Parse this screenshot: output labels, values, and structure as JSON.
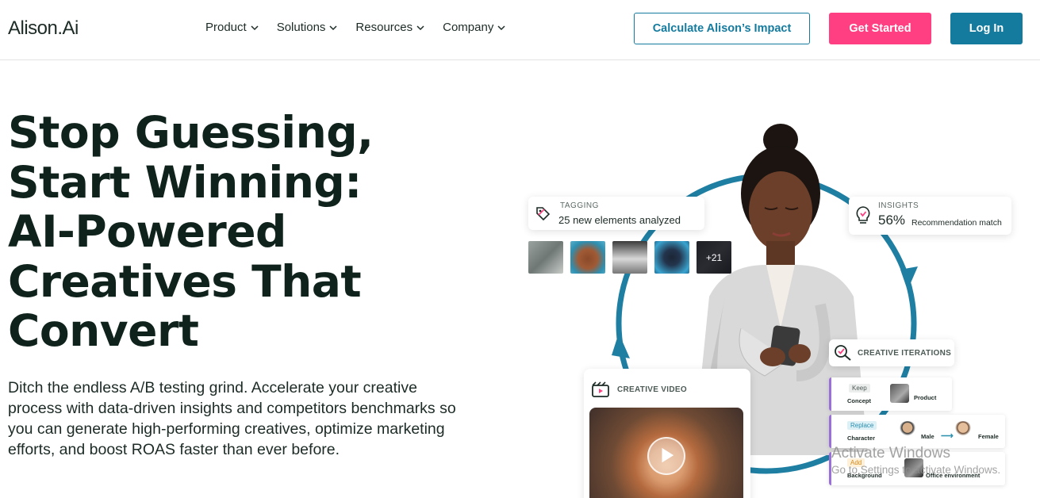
{
  "header": {
    "logo": "Alison.Ai",
    "nav": [
      {
        "label": "Product"
      },
      {
        "label": "Solutions"
      },
      {
        "label": "Resources"
      },
      {
        "label": "Company"
      }
    ],
    "impact_button": "Calculate Alison’s Impact",
    "start_button": "Get Started",
    "login_button": "Log In"
  },
  "hero": {
    "headline": [
      "Stop Guessing,",
      "Start Winning:",
      "AI-Powered",
      "Creatives That",
      "Convert"
    ],
    "subtext": "Ditch the endless A/B testing grind. Accelerate your creative process with data-driven insights and competitors benchmarks so you can generate high-performing creatives, optimize marketing efforts, and boost ROAS faster than ever before."
  },
  "visual": {
    "tagging": {
      "title": "TAGGING",
      "text": "25 new elements analyzed",
      "more": "+21"
    },
    "insights": {
      "title": "INSIGHTS",
      "value": "56%",
      "label": "Recommendation match"
    },
    "iterations": {
      "title": "CREATIVE ITERATIONS",
      "rows": [
        {
          "action": "Keep",
          "left": "Concept",
          "right": "Product"
        },
        {
          "action": "Replace",
          "left": "Character",
          "from": "Male",
          "to": "Female"
        },
        {
          "action": "Add",
          "left": "Background",
          "right": "Office environment"
        }
      ]
    },
    "video": {
      "title": "CREATIVE VIDEO"
    }
  },
  "watermark": {
    "line1": "Activate Windows",
    "line2": "Go to Settings to activate Windows."
  },
  "colors": {
    "accent": "#147b9e",
    "brand_pink": "#ff3f81",
    "headline": "#0f231c",
    "cycle_ring": "#1f7fa3",
    "iteration_bar": "#9b6fd8"
  }
}
